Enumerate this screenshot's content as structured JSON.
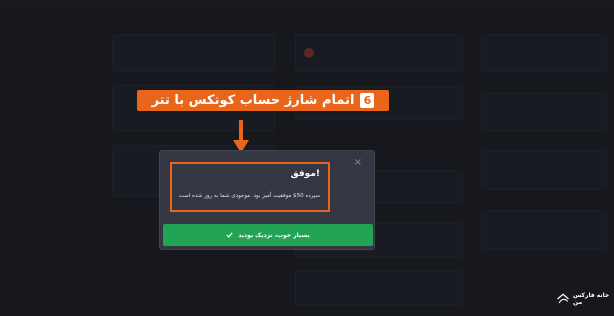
{
  "banner": {
    "step": "6",
    "text": "اتمام شارژ حساب کوتکس با تتر"
  },
  "modal": {
    "title": "!موفق",
    "message": "سپرده 50$ موفقیت آمیز بود. موجودی شما به روز شده است",
    "ok_button": "بسیار خوب، نزدیک بودید",
    "close_icon": "×"
  },
  "logo": {
    "text": "خانه فارکس من"
  },
  "colors": {
    "accent": "#e8651a",
    "success": "#23a455",
    "modal_bg": "#343741"
  }
}
